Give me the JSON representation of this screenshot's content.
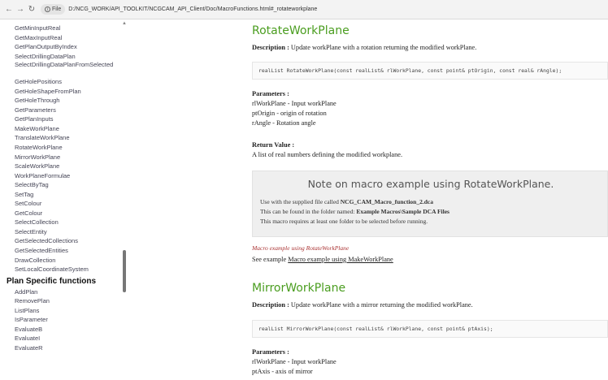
{
  "browser": {
    "file_chip": "File",
    "url": "D:/NCG_WORK/API_TOOLKIT/NCGCAM_API_Client/Doc/MacroFunctions.html#_rotateworkplane"
  },
  "sidebar": {
    "items_top": [
      "GetMinInputReal",
      "GetMaxInputReal",
      "GetPlanOutputByIndex",
      "SelectDrillingDataPlan",
      "SelectDrillingDataPlanFromSelected",
      "GetHolePositions",
      "GetHoleShapeFromPlan",
      "GetHoleThrough",
      "GetParameters",
      "GetPlanInputs",
      "MakeWorkPlane",
      "TranslateWorkPlane",
      "RotateWorkPlane",
      "MirrorWorkPlane",
      "ScaleWorkPlane",
      "WorkPlaneFormulae",
      "SelectByTag",
      "SetTag",
      "SetColour",
      "GetColour",
      "SelectCollection",
      "SelectEntity",
      "GetSelectedCollections",
      "GetSelectedEntities",
      "DrawCollection",
      "SetLocalCoordinateSystem"
    ],
    "heading": "Plan Specific functions",
    "items_bottom": [
      "AddPlan",
      "RemovePlan",
      "ListPlans",
      "IsParameter",
      "EvaluateB",
      "EvaluateI",
      "EvaluateR"
    ]
  },
  "rotate": {
    "title": "RotateWorkPlane",
    "desc_label": "Description :",
    "desc_text": " Update workPlane with a rotation returning the modified workPlane.",
    "code": "realList RotateWorkPlane(const realList& rlWorkPlane, const point& ptOrigin, const real& rAngle);",
    "params_label": "Parameters :",
    "params": [
      "rlWorkPlane - Input workPlane",
      "ptOrigin - origin of rotation",
      "rAngle - Rotation angle"
    ],
    "return_label": "Return Value :",
    "return_text": "A list of real numbers defining the modified workplane."
  },
  "note": {
    "title": "Note on macro example using RotateWorkPlane.",
    "line1_prefix": "Use with the supplied file called ",
    "line1_bold": "NCG_CAM_Macro_function_2.dca",
    "line2_prefix": "This can be found in the folder named:  ",
    "line2_bold": "Example Macros\\Sample DCA Files",
    "line3": "This macro requires at least one folder to be selected before running."
  },
  "example": {
    "italic_title": "Macro example using RotateWorkPlane",
    "see_prefix": "See example ",
    "see_link": "Macro example using MakeWorkPlane"
  },
  "mirror": {
    "title": "MirrorWorkPlane",
    "desc_label": "Description :",
    "desc_text": " Update workPlane with a mirror returning the modified workPlane.",
    "code": "realList MirrorWorkPlane(const realList& rlWorkPlane, const point& ptAxis);",
    "params_label": "Parameters :",
    "params": [
      "rlWorkPlane - Input workPlane",
      "ptAxis - axis of mirror"
    ]
  }
}
